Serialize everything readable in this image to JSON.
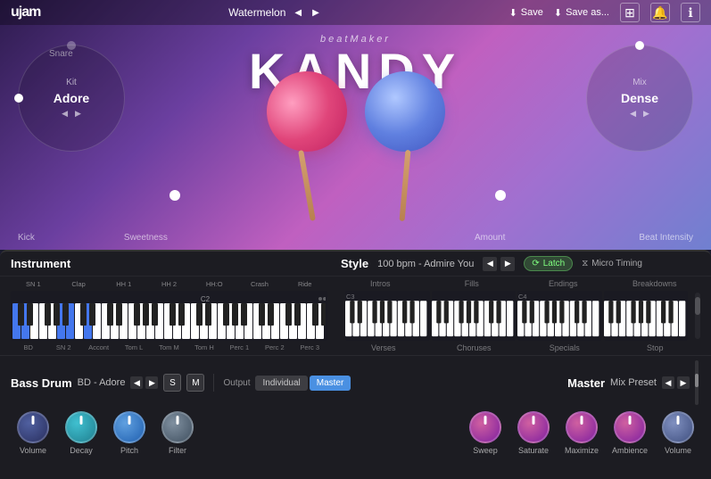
{
  "app": {
    "logo": "ujam",
    "preset_name": "Watermelon",
    "save_label": "Save",
    "save_as_label": "Save as...",
    "icons": {
      "grid": "⊞",
      "bell": "🔔",
      "info": "ℹ"
    }
  },
  "top": {
    "brand": "beatMaker",
    "title": "KANDY",
    "snare_label": "Snare",
    "kit_label": "Kit",
    "kit_value": "Adore",
    "mix_label": "Mix",
    "mix_value": "Dense",
    "kick_label": "Kick",
    "sweetness_label": "Sweetness",
    "amount_label": "Amount",
    "beat_intensity_label": "Beat Intensity"
  },
  "instrument": {
    "title": "Instrument",
    "drum_labels": [
      "BD",
      "SN 1",
      "SN 2",
      "Accont",
      "Tom L",
      "Tom M",
      "Tom H",
      "Perc 1",
      "Perc 2",
      "Perc 3"
    ],
    "top_labels": [
      "SN 1",
      "Clap",
      "HH 1",
      "HH 2",
      "HH:O",
      "Crash",
      "Ride"
    ],
    "note_c2": "C2"
  },
  "style": {
    "title": "Style",
    "bpm": "100 bpm",
    "preset": "Admire You",
    "latch_label": "Latch",
    "micro_timing_label": "Micro Timing",
    "sections": {
      "top": [
        "Intros",
        "Fills",
        "Endings",
        "Breakdowns"
      ],
      "bottom": [
        "Verses",
        "Choruses",
        "Specials",
        "Stop"
      ]
    },
    "note_c3": "C3",
    "note_c4": "C4"
  },
  "bass_drum": {
    "title": "Bass Drum",
    "preset": "BD - Adore",
    "s_label": "S",
    "m_label": "M",
    "output_individual": "Individual",
    "output_master": "Master",
    "knobs": [
      "Volume",
      "Decay",
      "Pitch",
      "Filter"
    ]
  },
  "master": {
    "title": "Master",
    "preset_label": "Mix Preset",
    "knobs": [
      "Sweep",
      "Saturate",
      "Maximize",
      "Ambience",
      "Volume"
    ]
  }
}
